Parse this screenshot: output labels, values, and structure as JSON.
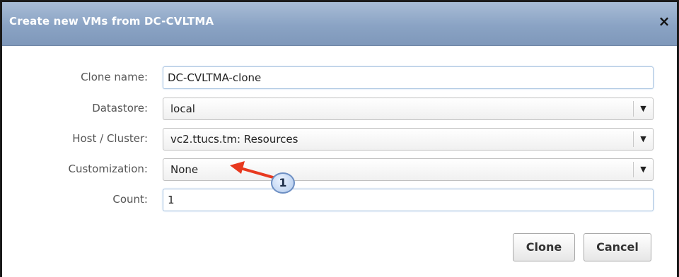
{
  "dialog": {
    "title": "Create new VMs from DC-CVLTMA",
    "close_symbol": "×"
  },
  "form": {
    "clone_name": {
      "label": "Clone name:",
      "value": "DC-CVLTMA-clone"
    },
    "datastore": {
      "label": "Datastore:",
      "value": "local"
    },
    "host_cluster": {
      "label": "Host / Cluster:",
      "value": "vc2.ttucs.tm: Resources"
    },
    "customization": {
      "label": "Customization:",
      "value": "None"
    },
    "count": {
      "label": "Count:",
      "value": "1"
    }
  },
  "annotation": {
    "number": "1",
    "arrow_color": "#e8391f"
  },
  "buttons": {
    "clone": "Clone",
    "cancel": "Cancel"
  },
  "icons": {
    "select_arrow": "▼",
    "close": "close-icon"
  },
  "colors": {
    "titlebar": "#8aa3c4",
    "title_text": "#ffffff",
    "annotation_arrow": "#e8391f"
  }
}
